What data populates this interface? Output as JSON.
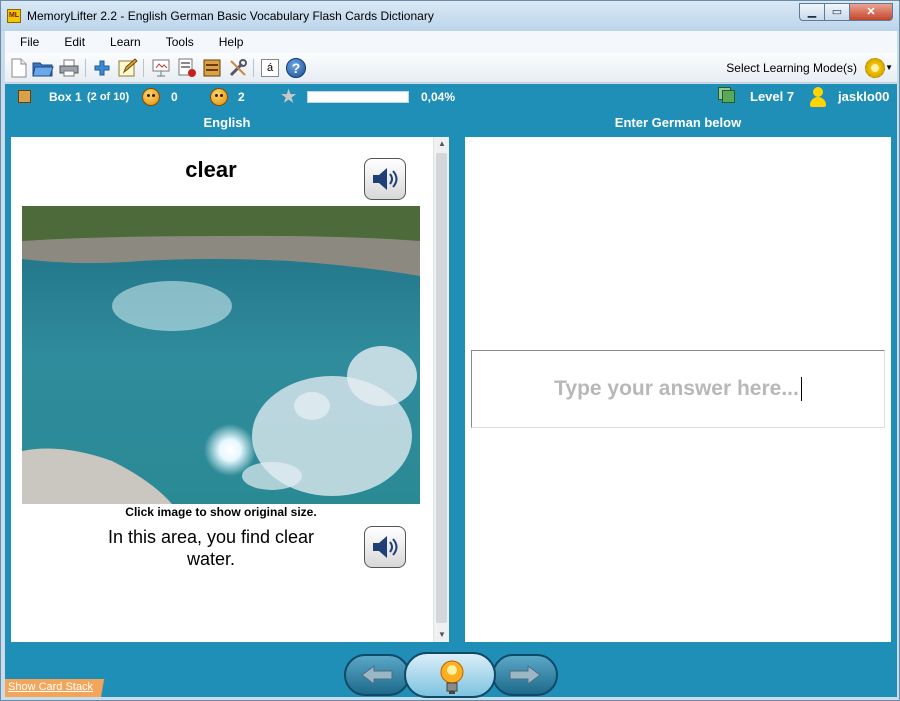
{
  "window": {
    "app_icon_text": "ML",
    "title": "MemoryLifter 2.2 - English German Basic Vocabulary Flash Cards Dictionary",
    "minimize": "▁",
    "maximize": "▭",
    "close": "✕"
  },
  "menu": [
    "File",
    "Edit",
    "Learn",
    "Tools",
    "Help"
  ],
  "toolbar": {
    "icons": [
      "new-document-icon",
      "open-folder-icon",
      "print-icon",
      "add-card-icon",
      "edit-card-icon",
      "slideshow-icon",
      "print-cards-icon",
      "box-icon",
      "settings-tools-icon",
      "special-characters-icon",
      "help-icon"
    ],
    "special_chars_label": "á",
    "help_label": "?",
    "mode_label": "Select Learning Mode(s)"
  },
  "status": {
    "box": "Box 1",
    "box_position": "(2 of 10)",
    "wrong_count": "0",
    "correct_count": "2",
    "progress_percent": 0.04,
    "progress_text": "0,04%",
    "level": "Level 7",
    "user": "jasklo00"
  },
  "panes": {
    "left_header": "English",
    "right_header": "Enter German below"
  },
  "card": {
    "word": "clear",
    "caption": "Click image to show original size.",
    "sentence": "In this area, you find clear water."
  },
  "answer": {
    "placeholder": "Type your answer here..."
  },
  "footer": {
    "show_stack": "Show Card Stack"
  },
  "colors": {
    "accent_blue": "#1f8fb8",
    "stack_orange": "#f3a65a"
  }
}
